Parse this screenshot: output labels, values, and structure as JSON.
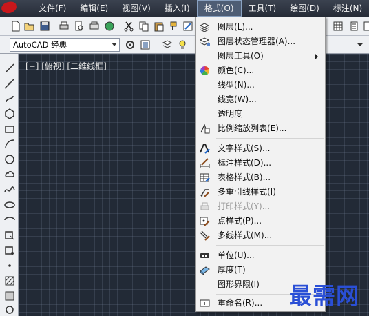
{
  "menubar": {
    "items": [
      {
        "label": "文件(F)",
        "active": false
      },
      {
        "label": "编辑(E)",
        "active": false
      },
      {
        "label": "视图(V)",
        "active": false
      },
      {
        "label": "插入(I)",
        "active": false
      },
      {
        "label": "格式(O)",
        "active": true
      },
      {
        "label": "工具(T)",
        "active": false
      },
      {
        "label": "绘图(D)",
        "active": false
      },
      {
        "label": "标注(N)",
        "active": false
      }
    ]
  },
  "toolbar": {
    "workspace_value": "AutoCAD 经典"
  },
  "viewport": {
    "label": "[−] [俯视] [二维线框]"
  },
  "format_menu": {
    "items": [
      {
        "label": "图层(L)...",
        "icon": "layer-icon",
        "disabled": false,
        "submenu": false
      },
      {
        "label": "图层状态管理器(A)...",
        "icon": "layer-state-icon",
        "disabled": false,
        "submenu": false
      },
      {
        "label": "图层工具(O)",
        "icon": "",
        "disabled": false,
        "submenu": true
      },
      {
        "label": "颜色(C)...",
        "icon": "color-wheel-icon",
        "disabled": false,
        "submenu": false
      },
      {
        "label": "线型(N)...",
        "icon": "",
        "disabled": false,
        "submenu": false
      },
      {
        "label": "线宽(W)...",
        "icon": "",
        "disabled": false,
        "submenu": false
      },
      {
        "label": "透明度",
        "icon": "",
        "disabled": false,
        "submenu": false
      },
      {
        "label": "比例缩放列表(E)...",
        "icon": "scale-list-icon",
        "disabled": false,
        "submenu": false
      },
      {
        "label": "文字样式(S)...",
        "icon": "text-style-icon",
        "disabled": false,
        "submenu": false
      },
      {
        "label": "标注样式(D)...",
        "icon": "dimension-style-icon",
        "disabled": false,
        "submenu": false
      },
      {
        "label": "表格样式(B)...",
        "icon": "table-style-icon",
        "disabled": false,
        "submenu": false
      },
      {
        "label": "多重引线样式(I)",
        "icon": "multileader-style-icon",
        "disabled": false,
        "submenu": false
      },
      {
        "label": "打印样式(Y)...",
        "icon": "plot-style-icon",
        "disabled": true,
        "submenu": false
      },
      {
        "label": "点样式(P)...",
        "icon": "point-style-icon",
        "disabled": false,
        "submenu": false
      },
      {
        "label": "多线样式(M)...",
        "icon": "multiline-style-icon",
        "disabled": false,
        "submenu": false
      },
      {
        "label": "单位(U)...",
        "icon": "units-icon",
        "disabled": false,
        "submenu": false
      },
      {
        "label": "厚度(T)",
        "icon": "thickness-icon",
        "disabled": false,
        "submenu": false
      },
      {
        "label": "图形界限(I)",
        "icon": "",
        "disabled": false,
        "submenu": false
      },
      {
        "label": "重命名(R)...",
        "icon": "rename-icon",
        "disabled": false,
        "submenu": false
      }
    ]
  },
  "watermark": "最需网",
  "colors": {
    "canvas": "#222a36",
    "menubar": "#2f3642",
    "menu_bg": "#f2f2f2",
    "watermark": "#2a4fd6"
  }
}
